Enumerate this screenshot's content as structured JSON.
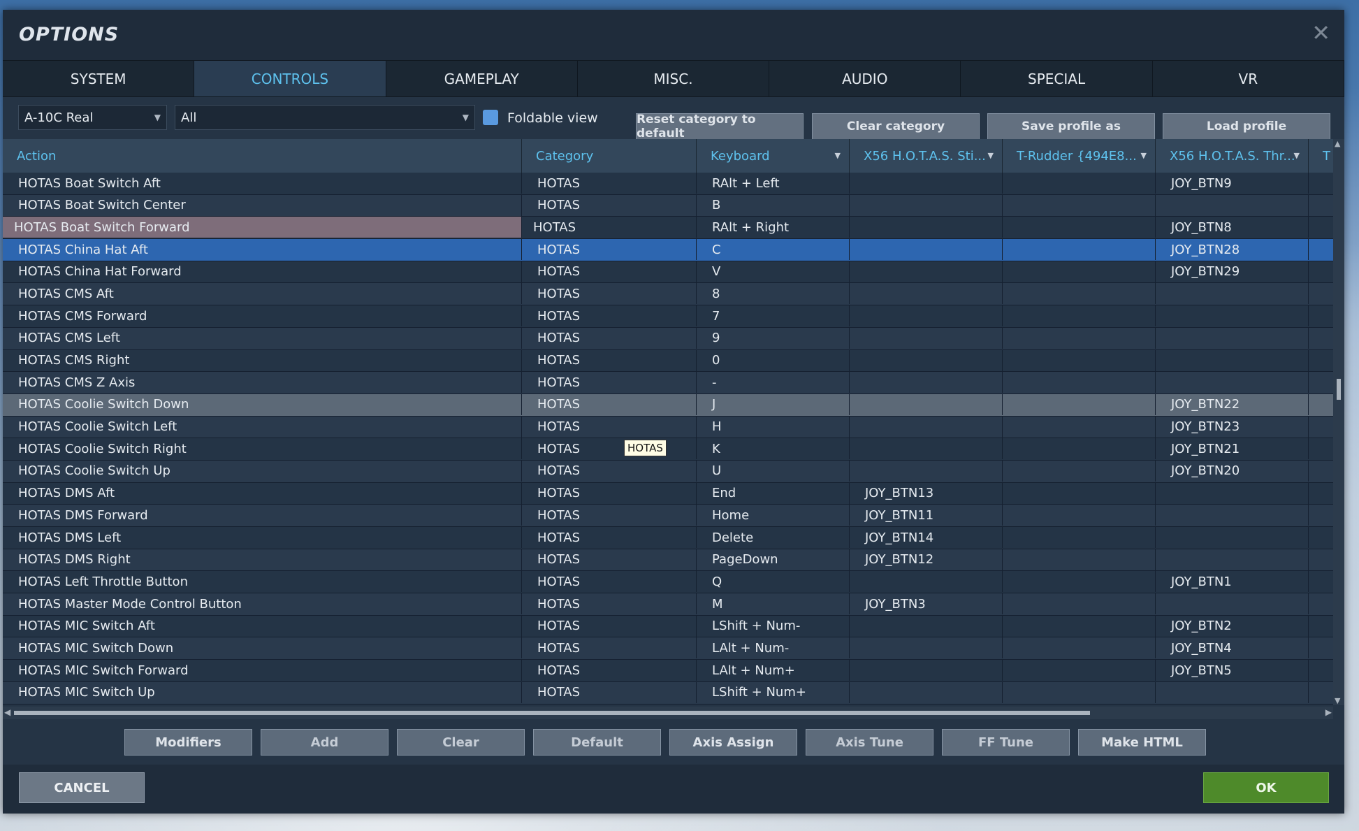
{
  "dialog": {
    "title": "OPTIONS",
    "close_glyph": "✕"
  },
  "tabs": [
    {
      "label": "SYSTEM"
    },
    {
      "label": "CONTROLS"
    },
    {
      "label": "GAMEPLAY"
    },
    {
      "label": "MISC."
    },
    {
      "label": "AUDIO"
    },
    {
      "label": "SPECIAL"
    },
    {
      "label": "VR"
    }
  ],
  "active_tab": "CONTROLS",
  "toolbar": {
    "aircraft_select": "A-10C Real",
    "category_select": "All",
    "foldable_view_label": "Foldable view",
    "foldable_view_checked": true,
    "reset_label": "Reset category to default",
    "clear_category_label": "Clear category",
    "save_profile_label": "Save profile as",
    "load_profile_label": "Load profile"
  },
  "grid": {
    "columns": [
      "Action",
      "Category",
      "Keyboard",
      "X56 H.O.T.A.S. Sti...",
      "T-Rudder {494E8...",
      "X56 H.O.T.A.S. Thr...",
      "T"
    ],
    "rows": [
      {
        "action": "HOTAS Boat Switch Aft",
        "category": "HOTAS",
        "keyboard": "RAlt + Left",
        "stick": "",
        "rudder": "",
        "throttle": "JOY_BTN9"
      },
      {
        "action": "HOTAS Boat Switch Center",
        "category": "HOTAS",
        "keyboard": "B",
        "stick": "",
        "rudder": "",
        "throttle": ""
      },
      {
        "action": "HOTAS Boat Switch Forward",
        "category": "HOTAS",
        "keyboard": "RAlt + Right",
        "stick": "",
        "rudder": "",
        "throttle": "JOY_BTN8"
      },
      {
        "action": "HOTAS China Hat Aft",
        "category": "HOTAS",
        "keyboard": "C",
        "stick": "",
        "rudder": "",
        "throttle": "JOY_BTN28"
      },
      {
        "action": "HOTAS China Hat Forward",
        "category": "HOTAS",
        "keyboard": "V",
        "stick": "",
        "rudder": "",
        "throttle": "JOY_BTN29"
      },
      {
        "action": "HOTAS CMS Aft",
        "category": "HOTAS",
        "keyboard": "8",
        "stick": "",
        "rudder": "",
        "throttle": ""
      },
      {
        "action": "HOTAS CMS Forward",
        "category": "HOTAS",
        "keyboard": "7",
        "stick": "",
        "rudder": "",
        "throttle": ""
      },
      {
        "action": "HOTAS CMS Left",
        "category": "HOTAS",
        "keyboard": "9",
        "stick": "",
        "rudder": "",
        "throttle": ""
      },
      {
        "action": "HOTAS CMS Right",
        "category": "HOTAS",
        "keyboard": "0",
        "stick": "",
        "rudder": "",
        "throttle": ""
      },
      {
        "action": "HOTAS CMS Z Axis",
        "category": "HOTAS",
        "keyboard": "-",
        "stick": "",
        "rudder": "",
        "throttle": ""
      },
      {
        "action": "HOTAS Coolie Switch Down",
        "category": "HOTAS",
        "keyboard": "J",
        "stick": "",
        "rudder": "",
        "throttle": "JOY_BTN22"
      },
      {
        "action": "HOTAS Coolie Switch Left",
        "category": "HOTAS",
        "keyboard": "H",
        "stick": "",
        "rudder": "",
        "throttle": "JOY_BTN23"
      },
      {
        "action": "HOTAS Coolie Switch Right",
        "category": "HOTAS",
        "keyboard": "K",
        "stick": "",
        "rudder": "",
        "throttle": "JOY_BTN21"
      },
      {
        "action": "HOTAS Coolie Switch Up",
        "category": "HOTAS",
        "keyboard": "U",
        "stick": "",
        "rudder": "",
        "throttle": "JOY_BTN20"
      },
      {
        "action": "HOTAS DMS Aft",
        "category": "HOTAS",
        "keyboard": "End",
        "stick": "JOY_BTN13",
        "rudder": "",
        "throttle": ""
      },
      {
        "action": "HOTAS DMS Forward",
        "category": "HOTAS",
        "keyboard": "Home",
        "stick": "JOY_BTN11",
        "rudder": "",
        "throttle": ""
      },
      {
        "action": "HOTAS DMS Left",
        "category": "HOTAS",
        "keyboard": "Delete",
        "stick": "JOY_BTN14",
        "rudder": "",
        "throttle": ""
      },
      {
        "action": "HOTAS DMS Right",
        "category": "HOTAS",
        "keyboard": "PageDown",
        "stick": "JOY_BTN12",
        "rudder": "",
        "throttle": ""
      },
      {
        "action": "HOTAS Left Throttle Button",
        "category": "HOTAS",
        "keyboard": "Q",
        "stick": "",
        "rudder": "",
        "throttle": "JOY_BTN1"
      },
      {
        "action": "HOTAS Master Mode Control Button",
        "category": "HOTAS",
        "keyboard": "M",
        "stick": "JOY_BTN3",
        "rudder": "",
        "throttle": ""
      },
      {
        "action": "HOTAS MIC Switch Aft",
        "category": "HOTAS",
        "keyboard": "LShift + Num-",
        "stick": "",
        "rudder": "",
        "throttle": "JOY_BTN2"
      },
      {
        "action": "HOTAS MIC Switch Down",
        "category": "HOTAS",
        "keyboard": "LAlt + Num-",
        "stick": "",
        "rudder": "",
        "throttle": "JOY_BTN4"
      },
      {
        "action": "HOTAS MIC Switch Forward",
        "category": "HOTAS",
        "keyboard": "LAlt + Num+",
        "stick": "",
        "rudder": "",
        "throttle": "JOY_BTN5"
      },
      {
        "action": "HOTAS MIC Switch Up",
        "category": "HOTAS",
        "keyboard": "LShift + Num+",
        "stick": "",
        "rudder": "",
        "throttle": ""
      }
    ],
    "selected_row": 3,
    "pressed_row": 2,
    "hover_row": 10
  },
  "tooltip": "HOTAS",
  "bottom_buttons": [
    "Modifiers",
    "Add",
    "Clear",
    "Default",
    "Axis Assign",
    "Axis Tune",
    "FF Tune",
    "Make HTML"
  ],
  "footer": {
    "cancel_label": "CANCEL",
    "ok_label": "OK"
  },
  "colors": {
    "accent": "#5ec2ee",
    "selected_row": "#2d66b0",
    "ok_green": "#4e8a2a"
  }
}
